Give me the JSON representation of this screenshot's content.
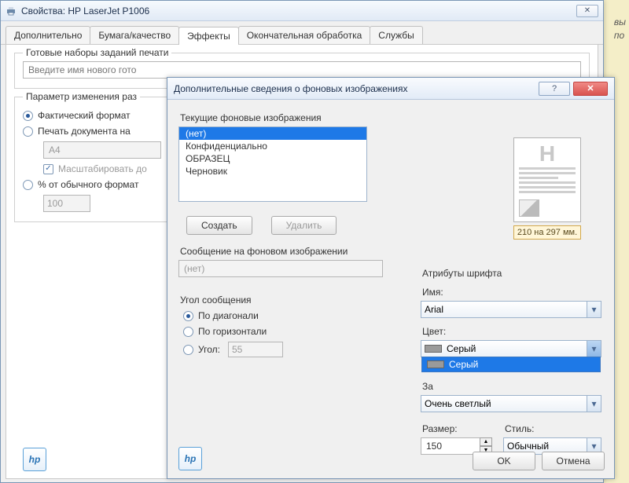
{
  "side_note_1": "вы",
  "side_note_2": "по",
  "main_window": {
    "title": "Свойства: HP LaserJet P1006",
    "tabs": [
      "Дополнительно",
      "Бумага/качество",
      "Эффекты",
      "Окончательная обработка",
      "Службы"
    ],
    "active_tab": 2,
    "presets_legend": "Готовые наборы заданий печати",
    "presets_placeholder": "Введите имя нового гото",
    "resize_legend": "Параметр изменения раз",
    "radio_actual": "Фактический формат",
    "radio_print_on": "Печать документа на",
    "paper_value": "A4",
    "check_scale": "Масштабировать до",
    "radio_percent": "% от обычного формат",
    "percent_value": "100"
  },
  "dialog": {
    "title": "Дополнительные сведения о фоновых изображениях",
    "current_label": "Текущие фоновые изображения",
    "list": [
      "(нет)",
      "Конфиденциально",
      "ОБРАЗЕЦ",
      "Черновик"
    ],
    "selected_index": 0,
    "btn_create": "Создать",
    "btn_delete": "Удалить",
    "message_label": "Сообщение на фоновом изображении",
    "message_value": "(нет)",
    "angle_label": "Угол сообщения",
    "angle_diag": "По диагонали",
    "angle_horiz": "По горизонтали",
    "angle_custom": "Угол:",
    "angle_value": "55",
    "preview_dim": "210 на 297 мм.",
    "font_attr_label": "Атрибуты шрифта",
    "name_label": "Имя:",
    "name_value": "Arial",
    "color_label": "Цвет:",
    "color_value": "Серый",
    "color_dropdown_option": "Серый",
    "shade_label": "За",
    "shade_value": "Очень светлый",
    "size_label": "Размер:",
    "size_value": "150",
    "style_label": "Стиль:",
    "style_value": "Обычный",
    "btn_ok": "OK",
    "btn_cancel": "Отмена"
  }
}
